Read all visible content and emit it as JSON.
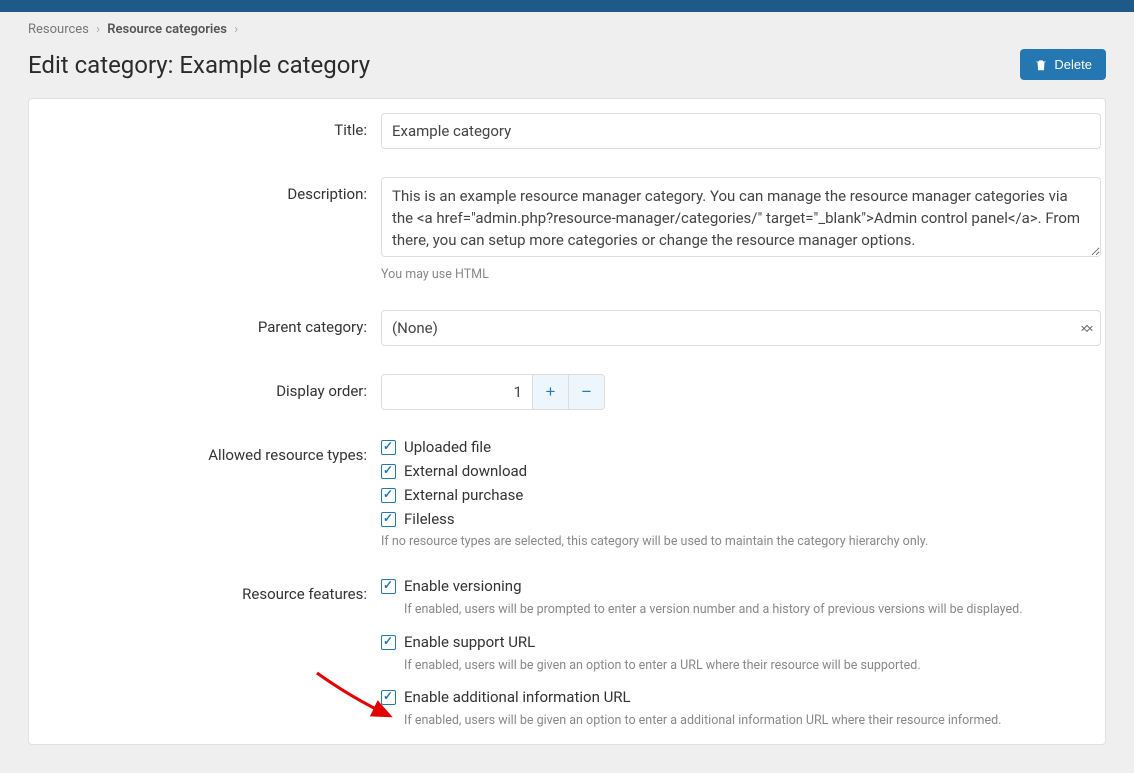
{
  "breadcrumb": {
    "root": "Resources",
    "current": "Resource categories"
  },
  "page_title": "Edit category: Example category",
  "delete_label": "Delete",
  "labels": {
    "title": "Title:",
    "description": "Description:",
    "parent": "Parent category:",
    "display_order": "Display order:",
    "allowed_types": "Allowed resource types:",
    "features": "Resource features:"
  },
  "title_value": "Example category",
  "description_value": "This is an example resource manager category. You can manage the resource manager categories via the <a href=\"admin.php?resource-manager/categories/\" target=\"_blank\">Admin control panel</a>. From there, you can setup more categories or change the resource manager options.",
  "description_hint": "You may use HTML",
  "parent_value": "(None)",
  "display_order_value": "1",
  "allowed_types": [
    {
      "label": "Uploaded file",
      "checked": true
    },
    {
      "label": "External download",
      "checked": true
    },
    {
      "label": "External purchase",
      "checked": true
    },
    {
      "label": "Fileless",
      "checked": true
    }
  ],
  "allowed_types_hint": "If no resource types are selected, this category will be used to maintain the category hierarchy only.",
  "features": [
    {
      "label": "Enable versioning",
      "desc": "If enabled, users will be prompted to enter a version number and a history of previous versions will be displayed.",
      "checked": true
    },
    {
      "label": "Enable support URL",
      "desc": "If enabled, users will be given an option to enter a URL where their resource will be supported.",
      "checked": true
    },
    {
      "label": "Enable additional information URL",
      "desc": "If enabled, users will be given an option to enter a additional information URL where their resource informed.",
      "checked": true
    }
  ]
}
